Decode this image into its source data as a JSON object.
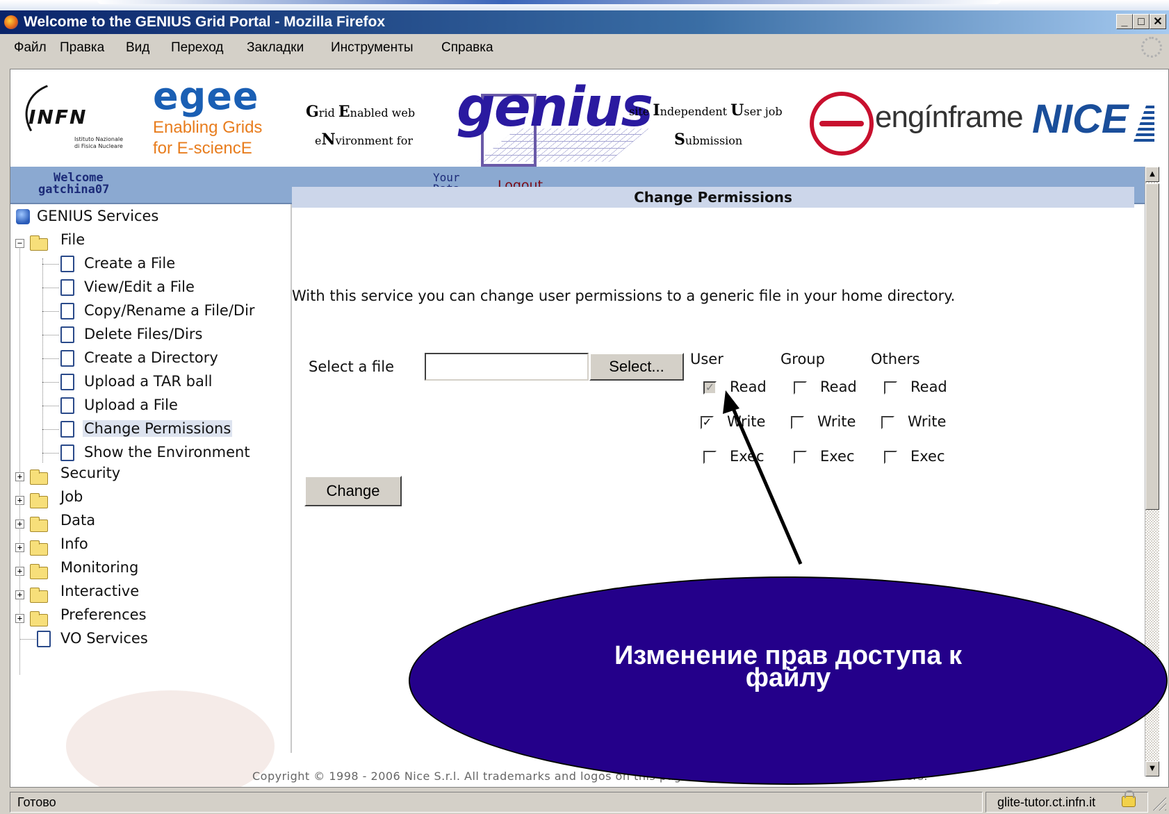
{
  "window": {
    "title": "Welcome to the GENIUS Grid Portal - Mozilla Firefox",
    "controls": [
      "_",
      "□",
      "✕"
    ]
  },
  "menu": [
    "Файл",
    "Правка",
    "Вид",
    "Переход",
    "Закладки",
    "Инструменты",
    "Справка"
  ],
  "banner": {
    "infn": "INFN",
    "infn_sub1": "Istituto Nazionale",
    "infn_sub2": "di Fisica Nucleare",
    "egee": "egee",
    "egee_sub1": "Enabling Grids",
    "egee_sub2": "for E-sciencE",
    "gew_line1": [
      "G",
      "rid ",
      "E",
      "nabled web"
    ],
    "gew_line2": [
      "e",
      "N",
      "vironment for"
    ],
    "genius": "genius",
    "siu_line1": [
      "site ",
      "I",
      "ndependent ",
      "U",
      "ser job"
    ],
    "siu_line2": [
      "S",
      "ubmission"
    ],
    "enginframe": "engínframe",
    "nice": "NICE"
  },
  "nav": {
    "welcome": "Welcome",
    "user": "gatchina07",
    "your": "Your",
    "data": "Data",
    "logout": "Logout"
  },
  "tree": {
    "root": "GENIUS Services",
    "file": "File",
    "file_items": [
      "Create a File",
      "View/Edit a File",
      "Copy/Rename a File/Dir",
      "Delete Files/Dirs",
      "Create a Directory",
      "Upload a TAR ball",
      "Upload a File",
      "Change Permissions",
      "Show the Environment"
    ],
    "folders": [
      "Security",
      "Job",
      "Data",
      "Info",
      "Monitoring",
      "Interactive",
      "Preferences"
    ],
    "vo": "VO Services",
    "selected": "Change Permissions"
  },
  "main": {
    "header": "Change Permissions",
    "description": "With this service you can change user permissions to a generic file in your home directory.",
    "select_label": "Select a file",
    "file_value": "",
    "select_button": "Select...",
    "columns": [
      "User",
      "Group",
      "Others"
    ],
    "rows": [
      "Read",
      "Write",
      "Exec"
    ],
    "checked": {
      "user": [
        true,
        true,
        false
      ],
      "group": [
        false,
        false,
        false
      ],
      "others": [
        false,
        false,
        false
      ]
    },
    "change_button": "Change"
  },
  "footer": "Copyright © 1998 - 2006 Nice S.r.l. All trademarks and logos on this page are property of their respective owners.",
  "status": {
    "left": "Готово",
    "right": "glite-tutor.ct.infn.it"
  },
  "callout": {
    "line1": "Изменение прав доступа к",
    "line2": "файлу"
  },
  "colors": {
    "titlebar": "#0a246a",
    "navbar": "#8ba9d1",
    "section_header": "#ccd6ea",
    "callout_fill": "#24008a",
    "callout_text": "#ffffff",
    "logout": "#7a0a14"
  }
}
